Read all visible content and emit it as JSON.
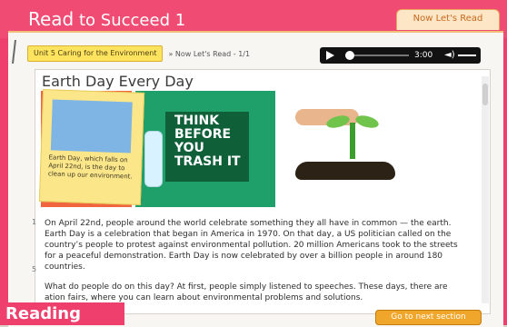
{
  "app": {
    "title_part1": "Read",
    "title_part2": "to Succeed",
    "title_part3": "1",
    "right_tab": "Now Let's Read"
  },
  "breadcrumb": {
    "unit": "Unit 5 Caring for the Environment",
    "section": "» Now Let's Read - 1/1"
  },
  "player": {
    "time": "3:00"
  },
  "content": {
    "heading": "Earth Day Every Day",
    "poster_text": [
      "THINK",
      "BEFORE",
      "YOU",
      "TRASH IT"
    ],
    "caption": "Earth Day, which falls on April 22nd, is the day to clean up our environment.",
    "paragraph1": "On April 22nd, people around the world celebrate something they all have in common — the earth. Earth Day is a celebration that began in America in 1970. On that day, a US politician called on the country’s people to protest against environmental pollution. 20 million Americans took to the streets for a peaceful demonstration. Earth Day is now celebrated by over a billion people in around 180 countries.",
    "paragraph2": "What do people do on this day? At first, people simply listened to speeches. These days, there are ation fairs, where you can learn about environmental problems and solutions.",
    "line_numbers": [
      "1",
      "5"
    ]
  },
  "footer": {
    "next_button": "Go to next section",
    "badge": "Reading"
  }
}
